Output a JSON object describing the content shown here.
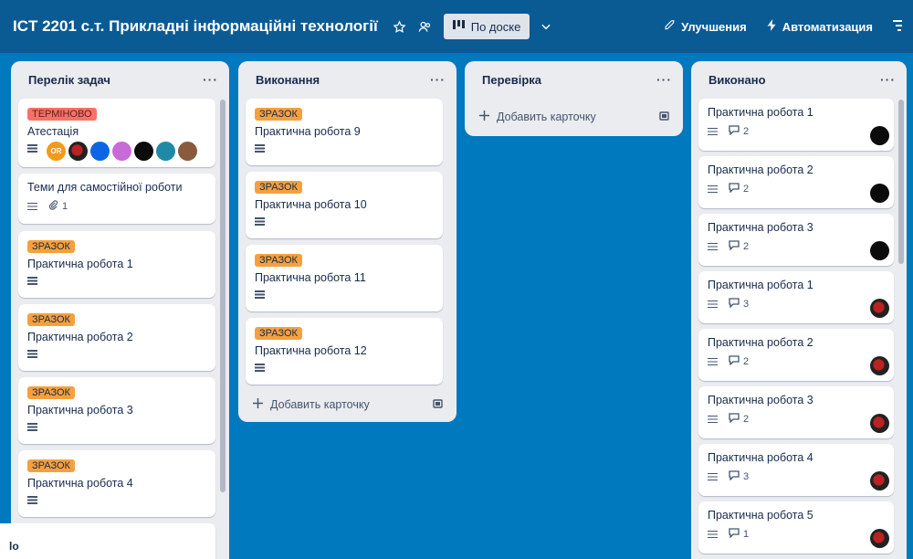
{
  "board": {
    "title": "ICT 2201 с.т. Прикладні інформаційні технології",
    "view_label": "По доске",
    "improvements_label": "Улучшения",
    "automation_label": "Автоматизация"
  },
  "lists": [
    {
      "title": "Перелік задач",
      "cards": [
        {
          "label": "ТЕРМІНОВО",
          "title": "Атестація",
          "badge_text": "OR"
        },
        {
          "title": "Теми для самостійної роботи",
          "attachments": "1"
        },
        {
          "label": "ЗРАЗОК",
          "title": "Практична робота 1"
        },
        {
          "label": "ЗРАЗОК",
          "title": "Практична робота 2"
        },
        {
          "label": "ЗРАЗОК",
          "title": "Практична робота 3"
        },
        {
          "label": "ЗРАЗОК",
          "title": "Практична робота 4"
        }
      ]
    },
    {
      "title": "Виконання",
      "cards": [
        {
          "label": "ЗРАЗОК",
          "title": "Практична робота 9"
        },
        {
          "label": "ЗРАЗОК",
          "title": "Практична робота 10"
        },
        {
          "label": "ЗРАЗОК",
          "title": "Практична робота 11"
        },
        {
          "label": "ЗРАЗОК",
          "title": "Практична робота 12"
        }
      ],
      "add_card": "Добавить карточку"
    },
    {
      "title": "Перевірка",
      "add_card": "Добавить карточку"
    },
    {
      "title": "Виконано",
      "cards": [
        {
          "title": "Практична робота 1",
          "comments": "2"
        },
        {
          "title": "Практична робота 2",
          "comments": "2"
        },
        {
          "title": "Практична робота 3",
          "comments": "2"
        },
        {
          "title": "Практична робота 1",
          "comments": "3"
        },
        {
          "title": "Практична робота 2",
          "comments": "2"
        },
        {
          "title": "Практична робота 3",
          "comments": "2"
        },
        {
          "title": "Практична робота 4",
          "comments": "3"
        },
        {
          "title": "Практична робота 5",
          "comments": "1"
        }
      ]
    }
  ],
  "toast": {
    "text": "lo"
  },
  "list_menu_label": "···",
  "colors": {
    "board_bg": "#0079bf",
    "header_bg": "#0a5b94",
    "list_bg": "#ebecf0",
    "label_orange": "#f5a03f",
    "label_red": "#f87168"
  }
}
